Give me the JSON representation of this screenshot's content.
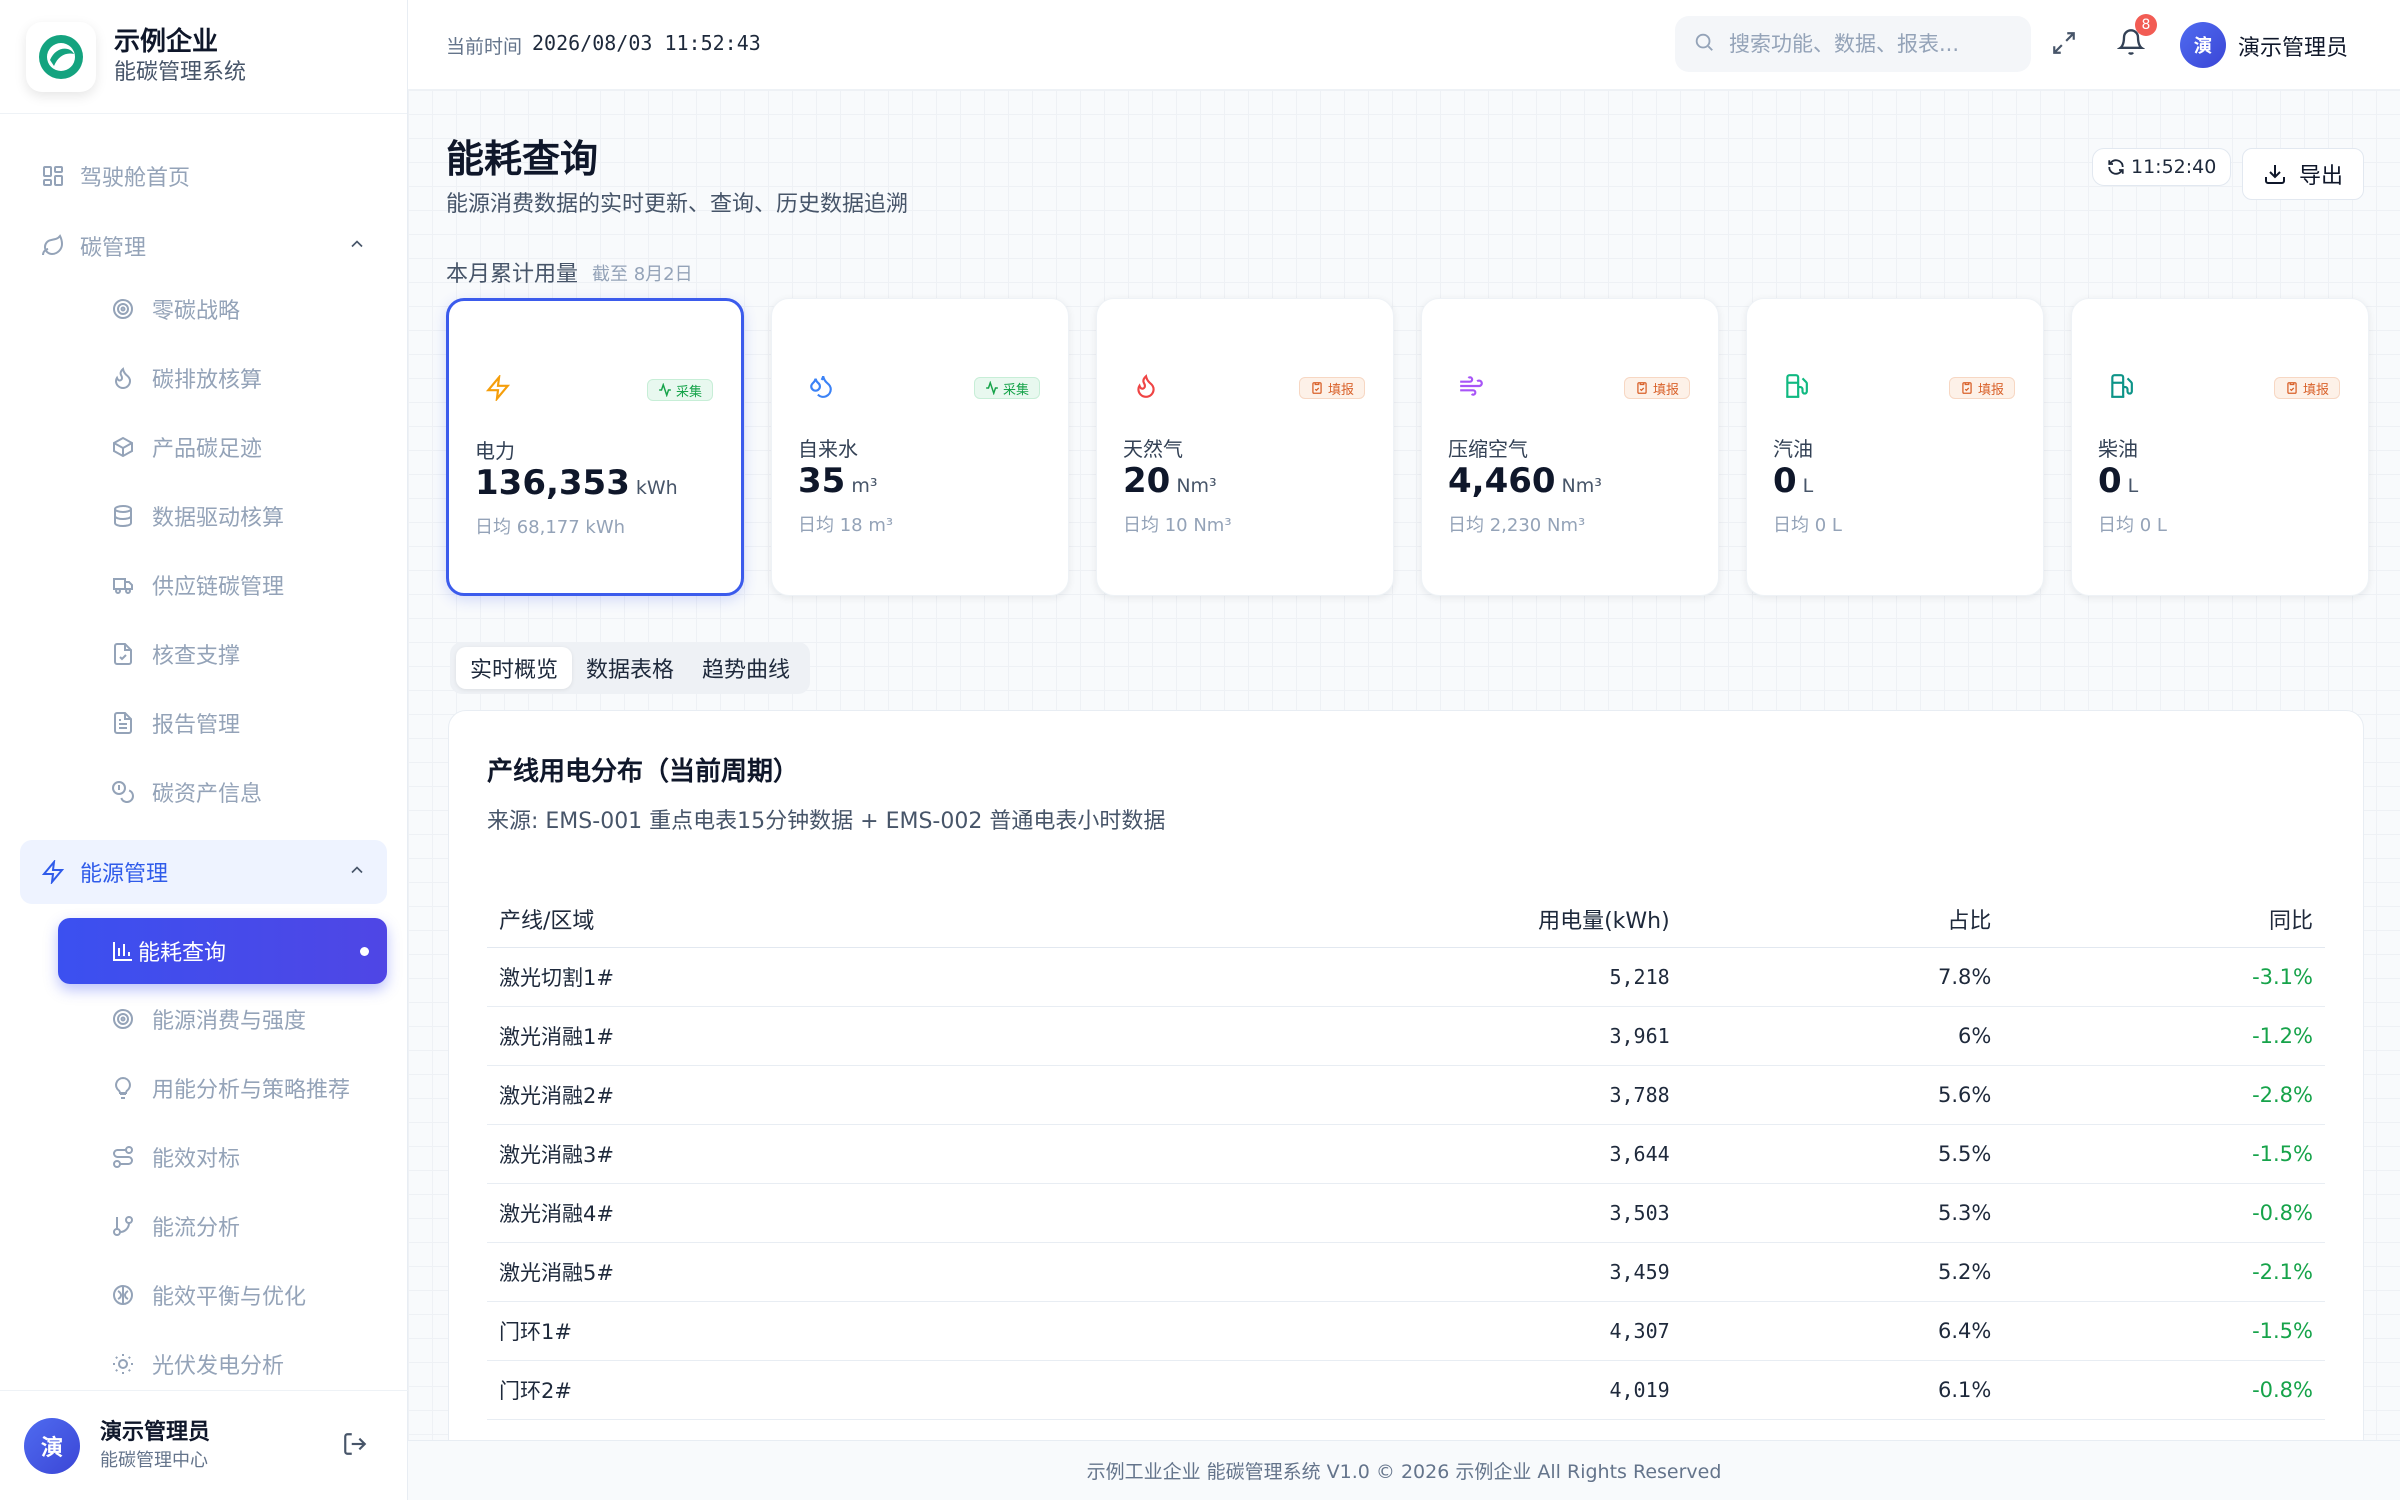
{
  "brand": {
    "name": "示例企业",
    "subtitle": "能碳管理系统"
  },
  "sidebar": {
    "top_items": [
      {
        "label": "驾驶舱首页",
        "icon": "grid-icon"
      },
      {
        "label": "碳管理",
        "icon": "leaf-icon",
        "expanded": true
      }
    ],
    "carbon_items": [
      {
        "label": "零碳战略",
        "icon": "target-icon"
      },
      {
        "label": "碳排放核算",
        "icon": "flame-icon"
      },
      {
        "label": "产品碳足迹",
        "icon": "box-icon"
      },
      {
        "label": "数据驱动核算",
        "icon": "database-icon"
      },
      {
        "label": "供应链碳管理",
        "icon": "truck-icon"
      },
      {
        "label": "核查支撑",
        "icon": "file-check-icon"
      },
      {
        "label": "报告管理",
        "icon": "file-text-icon"
      },
      {
        "label": "碳资产信息",
        "icon": "coins-icon"
      }
    ],
    "energy_group": {
      "label": "能源管理",
      "icon": "lightning-icon",
      "expanded": true
    },
    "energy_items": [
      {
        "label": "能耗查询",
        "icon": "bar-chart-icon",
        "active": true
      },
      {
        "label": "能源消费与强度",
        "icon": "target-icon"
      },
      {
        "label": "用能分析与策略推荐",
        "icon": "lightbulb-icon"
      },
      {
        "label": "能效对标",
        "icon": "route-icon"
      },
      {
        "label": "能流分析",
        "icon": "git-branch-icon"
      },
      {
        "label": "能效平衡与优化",
        "icon": "brain-icon"
      },
      {
        "label": "光伏发电分析",
        "icon": "sun-icon"
      }
    ],
    "user": {
      "avatar": "演",
      "name": "演示管理员",
      "role": "能碳管理中心"
    }
  },
  "topbar": {
    "time_label": "当前时间",
    "time_value": "2026/08/03 11:52:43",
    "search_placeholder": "搜索功能、数据、报表...",
    "notifications": "8",
    "avatar": "演",
    "user": "演示管理员"
  },
  "page": {
    "title": "能耗查询",
    "subtitle": "能源消费数据的实时更新、查询、历史数据追溯",
    "refresh_time": "11:52:40",
    "export_label": "导出",
    "section_label": "本月累计用量",
    "section_note": "截至 8月2日"
  },
  "cards": [
    {
      "name": "电力",
      "value": "136,353",
      "unit": "kWh",
      "avg": "日均 68,177 kWh",
      "tag": "采集",
      "tag_type": "collect",
      "icon": "lightning-icon",
      "color": "#f59e0b",
      "active": true
    },
    {
      "name": "自来水",
      "value": "35",
      "unit": "m³",
      "avg": "日均 18 m³",
      "tag": "采集",
      "tag_type": "collect",
      "icon": "droplets-icon",
      "color": "#3b82f6"
    },
    {
      "name": "天然气",
      "value": "20",
      "unit": "Nm³",
      "avg": "日均 10 Nm³",
      "tag": "填报",
      "tag_type": "manual",
      "icon": "flame-icon",
      "color": "#ef4444"
    },
    {
      "name": "压缩空气",
      "value": "4,460",
      "unit": "Nm³",
      "avg": "日均 2,230 Nm³",
      "tag": "填报",
      "tag_type": "manual",
      "icon": "wind-icon",
      "color": "#a855f7"
    },
    {
      "name": "汽油",
      "value": "0",
      "unit": "L",
      "avg": "日均 0 L",
      "tag": "填报",
      "tag_type": "manual",
      "icon": "fuel-icon",
      "color": "#10b981"
    },
    {
      "name": "柴油",
      "value": "0",
      "unit": "L",
      "avg": "日均 0 L",
      "tag": "填报",
      "tag_type": "manual",
      "icon": "fuel-icon",
      "color": "#0d9488"
    }
  ],
  "tabs": [
    {
      "label": "实时概览",
      "selected": true
    },
    {
      "label": "数据表格"
    },
    {
      "label": "趋势曲线"
    }
  ],
  "panel": {
    "title": "产线用电分布（当前周期）",
    "source": "来源: EMS-001 重点电表15分钟数据 + EMS-002 普通电表小时数据",
    "columns": [
      "产线/区域",
      "用电量(kWh)",
      "占比",
      "同比"
    ],
    "rows": [
      [
        "激光切割1#",
        "5,218",
        "7.8%",
        "-3.1%"
      ],
      [
        "激光消融1#",
        "3,961",
        "6%",
        "-1.2%"
      ],
      [
        "激光消融2#",
        "3,788",
        "5.6%",
        "-2.8%"
      ],
      [
        "激光消融3#",
        "3,644",
        "5.5%",
        "-1.5%"
      ],
      [
        "激光消融4#",
        "3,503",
        "5.3%",
        "-0.8%"
      ],
      [
        "激光消融5#",
        "3,459",
        "5.2%",
        "-2.1%"
      ],
      [
        "门环1#",
        "4,307",
        "6.4%",
        "-1.5%"
      ],
      [
        "门环2#",
        "4,019",
        "6.1%",
        "-0.8%"
      ]
    ]
  },
  "footer": "示例工业企业 能碳管理系统 V1.0 © 2026 示例企业 All Rights Reserved"
}
